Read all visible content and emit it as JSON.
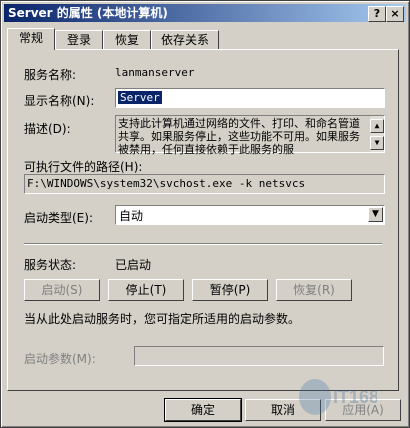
{
  "window": {
    "title": "Server 的属性 (本地计算机)",
    "help_btn": "?",
    "close_btn": "×"
  },
  "tabs": [
    "常规",
    "登录",
    "恢复",
    "依存关系"
  ],
  "general": {
    "service_name_label": "服务名称:",
    "service_name_value": "lanmanserver",
    "display_name_label": "显示名称(N):",
    "display_name_value": "Server",
    "description_label": "描述(D):",
    "description_value": "支持此计算机通过网络的文件、打印、和命名管道共享。如果服务停止，这些功能不可用。如果服务被禁用，任何直接依赖于此服务的服",
    "exe_path_label": "可执行文件的路径(H):",
    "exe_path_value": "F:\\WINDOWS\\system32\\svchost.exe -k netsvcs",
    "startup_type_label": "启动类型(E):",
    "startup_type_value": "自动",
    "service_status_label": "服务状态:",
    "service_status_value": "已启动",
    "start_btn": "启动(S)",
    "stop_btn": "停止(T)",
    "pause_btn": "暂停(P)",
    "resume_btn": "恢复(R)",
    "hint": "当从此处启动服务时，您可指定所适用的启动参数。",
    "params_label": "启动参数(M):",
    "params_value": ""
  },
  "footer": {
    "ok": "确定",
    "cancel": "取消",
    "apply": "应用(A)"
  },
  "watermark": "IT168.com"
}
